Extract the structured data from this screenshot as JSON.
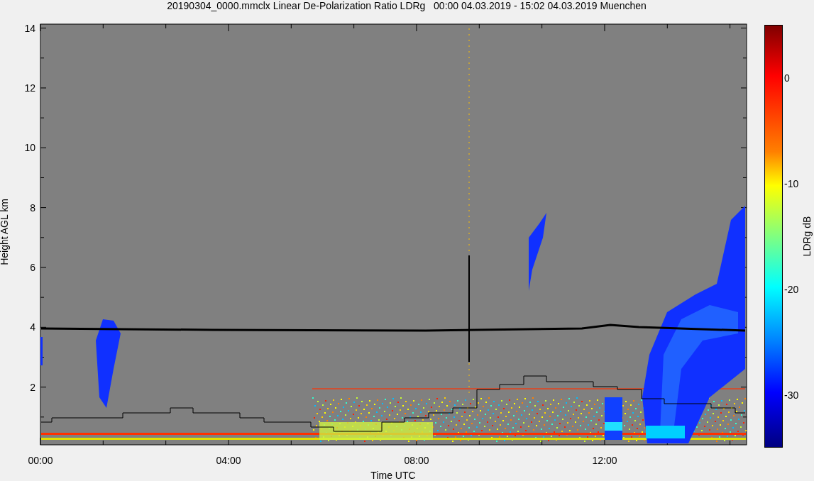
{
  "title": "20190304_0000.mmclx Linear De-Polarization Ratio LDRg   00:00 04.03.2019 - 15:02 04.03.2019 Muenchen",
  "y_axis": {
    "label": "Height AGL km",
    "ticks": [
      "14",
      "12",
      "10",
      "8",
      "6",
      "4",
      "2"
    ]
  },
  "x_axis": {
    "label": "Time UTC",
    "ticks": [
      "00:00",
      "04:00",
      "08:00",
      "12:00"
    ]
  },
  "colorbar": {
    "label": "LDRg dB",
    "ticks": [
      "0",
      "-10",
      "-20",
      "-30"
    ]
  }
}
